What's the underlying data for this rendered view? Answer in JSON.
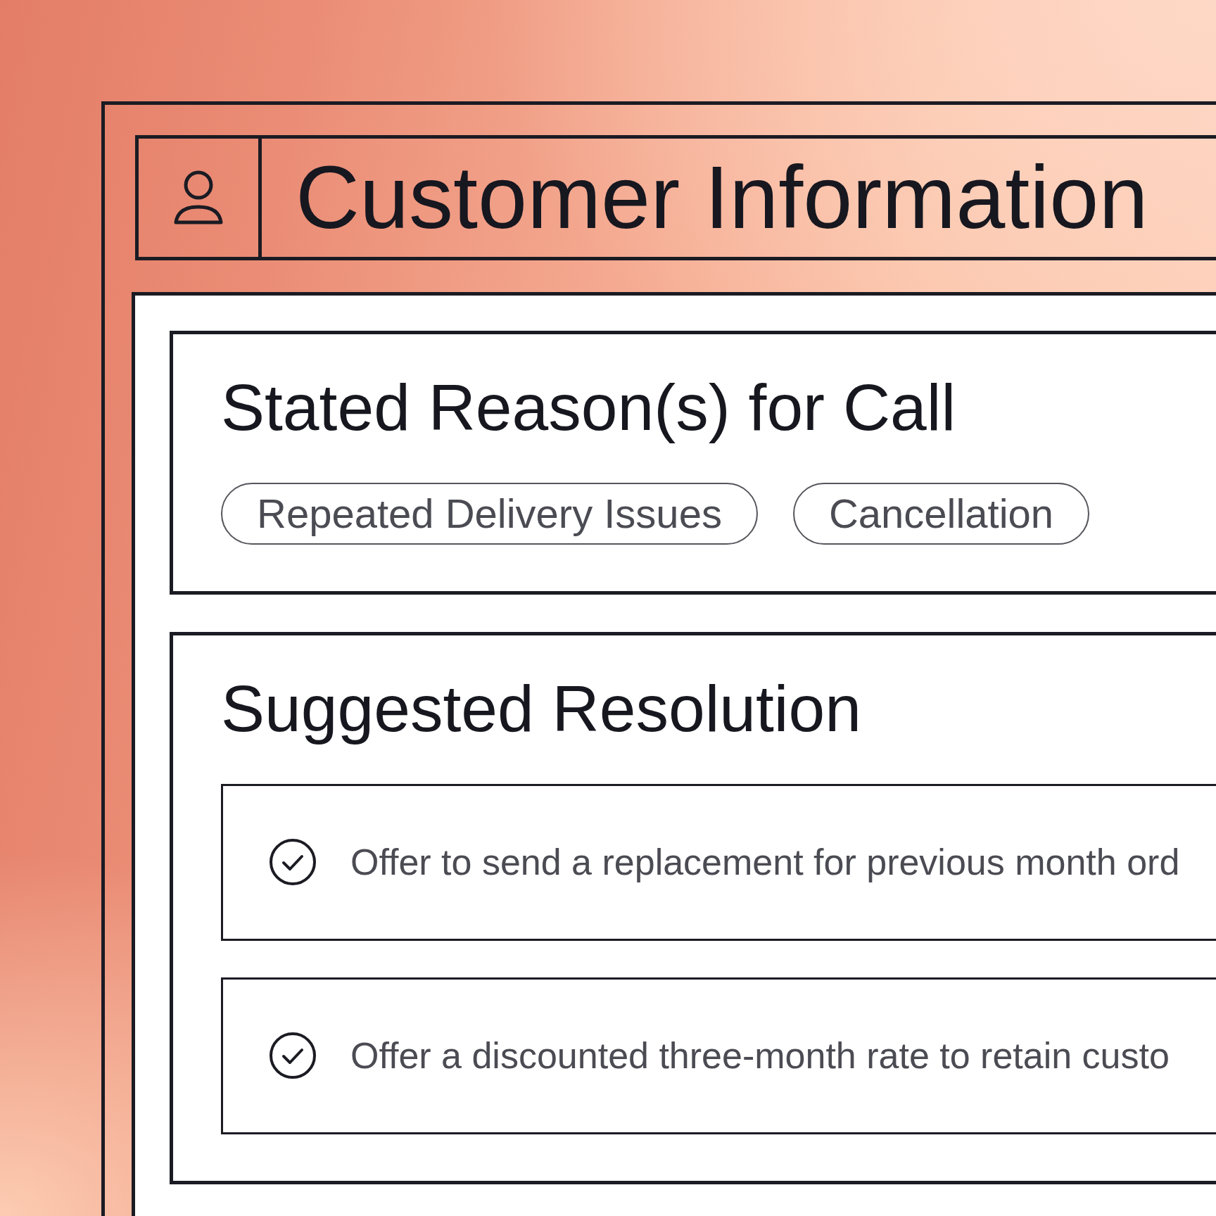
{
  "header": {
    "title": "Customer Information"
  },
  "sections": [
    {
      "kind": "tags",
      "title": "Stated Reason(s) for Call",
      "tags": [
        "Repeated Delivery Issues",
        "Cancellation"
      ]
    },
    {
      "kind": "suggestions",
      "title": "Suggested Resolution",
      "items": [
        {
          "text": "Offer to send a replacement for previous month ord"
        },
        {
          "text": "Offer a discounted three-month rate to retain custo"
        }
      ]
    }
  ]
}
